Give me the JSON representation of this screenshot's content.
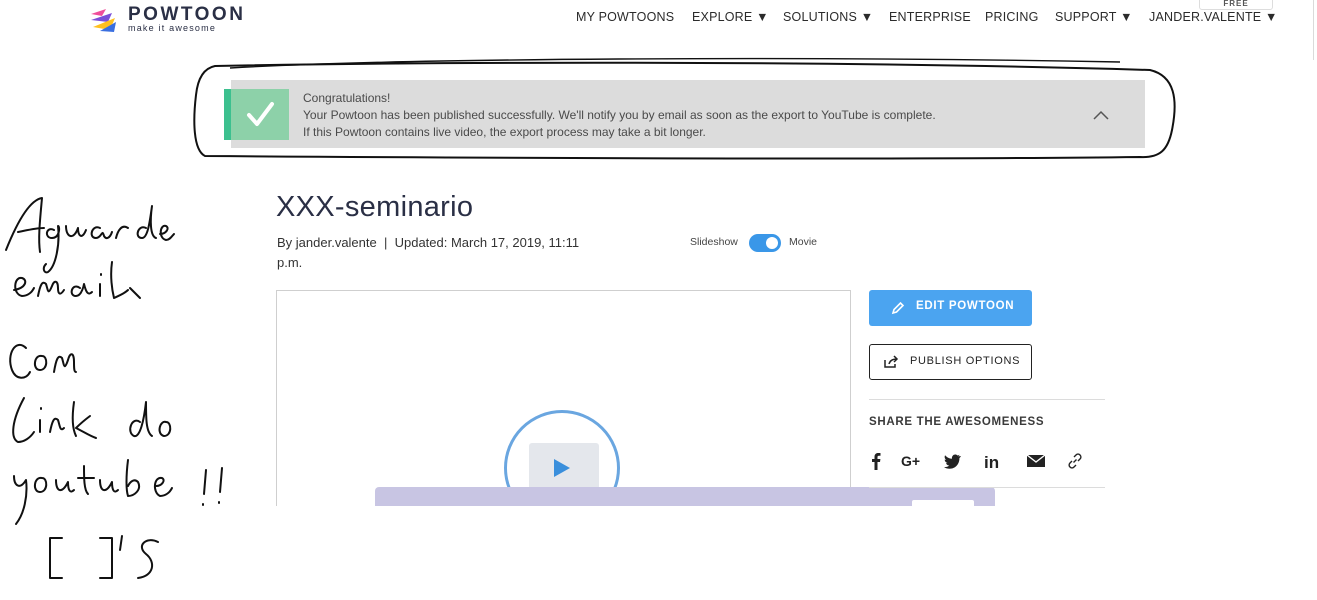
{
  "header": {
    "logo_word": "POWTOON",
    "logo_tagline": "make it awesome",
    "nav": {
      "my_powtoons": "MY POWTOONS",
      "explore": "EXPLORE",
      "solutions": "SOLUTIONS",
      "enterprise": "ENTERPRISE",
      "pricing": "PRICING",
      "support": "SUPPORT",
      "user": "JANDER.VALENTE",
      "dropdown_glyph": "▼"
    },
    "plan_badge": "FREE"
  },
  "notification": {
    "line1": "Congratulations!",
    "line2": "Your Powtoon has been published successfully. We'll notify you by email as soon as the export to YouTube is complete.",
    "line3": "If this Powtoon contains live video, the export process may take a bit longer.",
    "accent_color": "#3cc08f"
  },
  "powtoon": {
    "title": "XXX-seminario",
    "byline": "By jander.valente",
    "separator": "|",
    "updated": "Updated: March 17, 2019, 11:11 p.m.",
    "view_toggle": {
      "left_label": "Slideshow",
      "right_label": "Movie",
      "selected": "Movie"
    }
  },
  "actions": {
    "edit_label": "EDIT POWTOON",
    "publish_label": "PUBLISH OPTIONS"
  },
  "share": {
    "title": "SHARE THE AWESOMENESS",
    "icons": [
      "facebook-icon",
      "google-plus-icon",
      "twitter-icon",
      "linkedin-icon",
      "email-icon",
      "link-icon"
    ]
  },
  "annotation": {
    "handwritten_lines": [
      "Aguarde",
      "email",
      "Com",
      "link do",
      "youtube !!",
      "[ ]'s"
    ]
  },
  "colors": {
    "primary_blue": "#4ba4f0",
    "brand_dark": "#2a2f45",
    "banner_bg": "#dcdcdc"
  }
}
